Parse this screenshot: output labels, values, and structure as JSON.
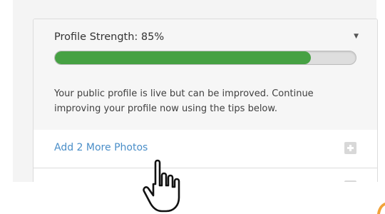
{
  "profile_strength": {
    "title": "Profile Strength: 85%",
    "percent": 85,
    "toggle_glyph": "▼",
    "description": "Your public profile is live but can be improved. Continue improving your profile now using the tips below."
  },
  "tips": [
    {
      "label": "Add 2 More Photos",
      "action_icon": "plus-icon"
    },
    {
      "label": "",
      "action_icon": "plus-icon"
    }
  ],
  "colors": {
    "progress_fill": "#46a143",
    "link": "#4a8ec8",
    "panel_header_bg": "#f6f6f6",
    "accent_orange": "#f2a33a"
  },
  "cursor": {
    "type": "hand-pointer"
  }
}
